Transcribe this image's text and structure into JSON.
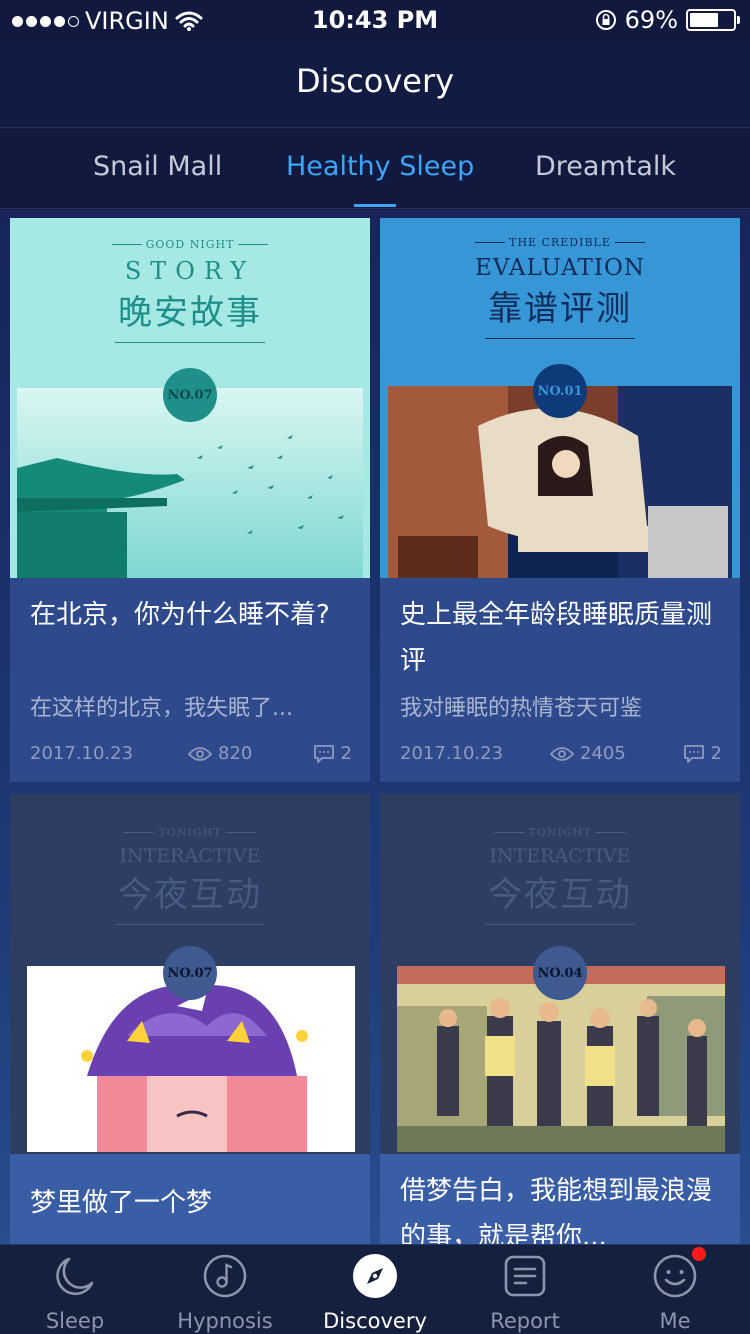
{
  "status_bar": {
    "carrier": "VIRGIN",
    "time": "10:43 PM",
    "battery": "69%"
  },
  "nav": {
    "title": "Discovery"
  },
  "tabs": [
    {
      "label": "Snail Mall"
    },
    {
      "label": "Healthy Sleep"
    },
    {
      "label": "Dreamtalk"
    }
  ],
  "cards": [
    {
      "image": {
        "kicker": "GOOD NIGHT",
        "heading": "STORY",
        "heading_cn": "晚安故事",
        "badge": "NO.07"
      },
      "title": "在北京，你为什么睡不着?",
      "description": "在这样的北京，我失眠了...",
      "date": "2017.10.23",
      "views": "820",
      "comments": "2"
    },
    {
      "image": {
        "kicker": "THE CREDIBLE",
        "heading": "EVALUATION",
        "heading_cn": "靠谱评测",
        "badge": "NO.01"
      },
      "title": "史上最全年龄段睡眠质量测评",
      "description": "我对睡眠的热情苍天可鉴",
      "date": "2017.10.23",
      "views": "2405",
      "comments": "2"
    },
    {
      "image": {
        "kicker": "TONIGHT",
        "heading": "INTERACTIVE",
        "heading_cn": "今夜互动",
        "badge": "NO.07"
      },
      "title": "梦里做了一个梦"
    },
    {
      "image": {
        "kicker": "TONIGHT",
        "heading": "INTERACTIVE",
        "heading_cn": "今夜互动",
        "badge": "NO.04"
      },
      "title": "借梦告白，我能想到最浪漫的事，就是帮你..."
    }
  ],
  "tab_bar": [
    {
      "label": "Sleep",
      "icon": "moon-icon"
    },
    {
      "label": "Hypnosis",
      "icon": "music-note-icon"
    },
    {
      "label": "Discovery",
      "icon": "compass-icon"
    },
    {
      "label": "Report",
      "icon": "report-icon"
    },
    {
      "label": "Me",
      "icon": "smiley-icon"
    }
  ],
  "colors": {
    "accent": "#3da4f6",
    "background": "#141f45",
    "notification": "#ff1a1a"
  }
}
